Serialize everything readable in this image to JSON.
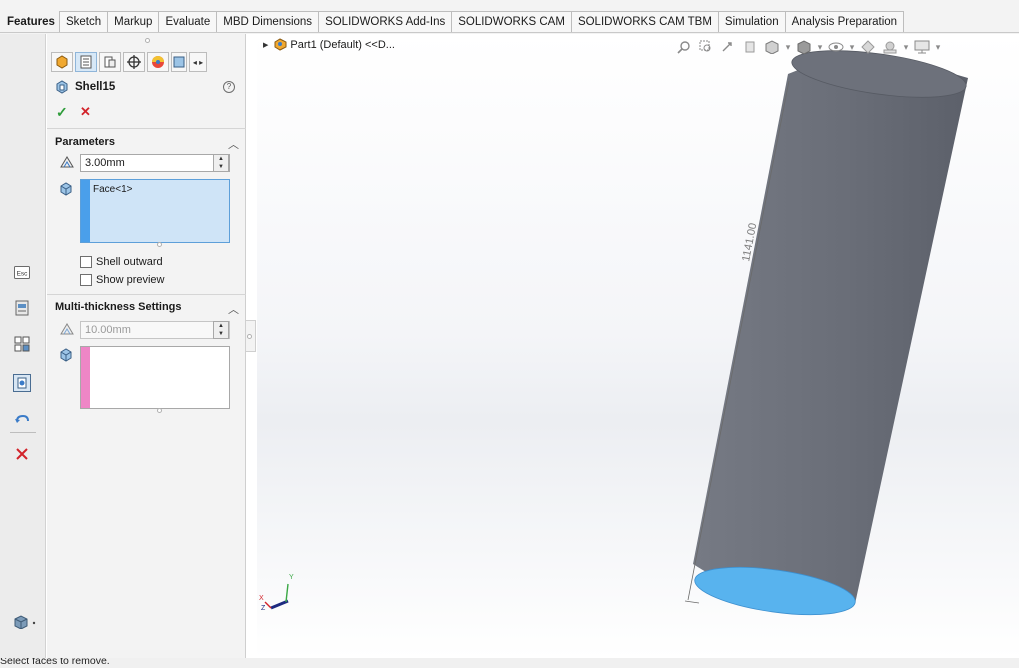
{
  "tabs": [
    "Features",
    "Sketch",
    "Markup",
    "Evaluate",
    "MBD Dimensions",
    "SOLIDWORKS Add-Ins",
    "SOLIDWORKS CAM",
    "SOLIDWORKS CAM TBM",
    "Simulation",
    "Analysis Preparation"
  ],
  "active_tab": "Features",
  "feature": {
    "title": "Shell15",
    "ok_label": "✓",
    "cancel_label": "✕",
    "help_label": "?"
  },
  "parameters": {
    "header": "Parameters",
    "thickness": "3.00mm",
    "faces": [
      "Face<1>"
    ],
    "shell_outward_label": "Shell outward",
    "show_preview_label": "Show preview",
    "shell_outward_checked": false,
    "show_preview_checked": false
  },
  "multi_thickness": {
    "header": "Multi-thickness Settings",
    "thickness": "10.00mm"
  },
  "tree": {
    "part_label": "Part1 (Default) <<D..."
  },
  "view": {
    "dimension_label": "1141.00",
    "triad_x": "X",
    "triad_y": "Y",
    "triad_z": "Z"
  },
  "status": {
    "text": "Select faces to remove."
  },
  "colors": {
    "face_selected": "#58b3ee",
    "cylinder_body": "#6e727c",
    "faces_bar": "#4a9fea",
    "multi_bar": "#ee86c6",
    "ok": "#2e9c3a",
    "cancel": "#d2232a"
  },
  "icons": {
    "left_toolbar": [
      "esc-icon",
      "print-icon",
      "grid-icon",
      "snap-icon",
      "undo-icon",
      "close-icon",
      "cube-dropdown-icon"
    ],
    "pm_tabs": [
      "feature-manager-icon",
      "property-manager-icon",
      "configuration-manager-icon",
      "dimxpert-icon",
      "display-manager-icon",
      "cam-manager-icon"
    ]
  }
}
